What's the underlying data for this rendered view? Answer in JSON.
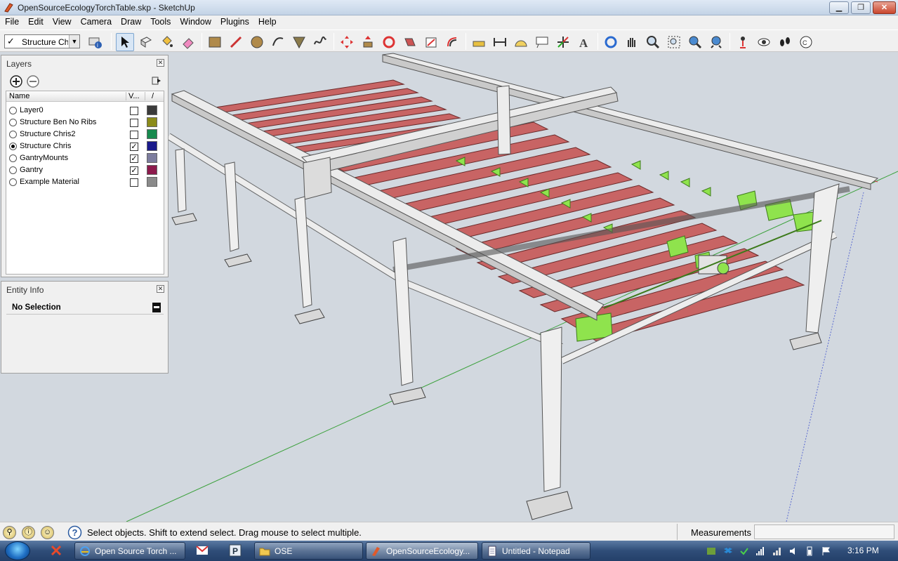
{
  "window": {
    "title": "OpenSourceEcologyTorchTable.skp - SketchUp",
    "minimize": "▁",
    "maximize": "❐",
    "close": "✕"
  },
  "menu": [
    "File",
    "Edit",
    "View",
    "Camera",
    "Draw",
    "Tools",
    "Window",
    "Plugins",
    "Help"
  ],
  "toolbar": {
    "layer_select_value": "Structure Chris",
    "tools": [
      "layer-manager-icon",
      "select-icon",
      "make-component-icon",
      "paint-bucket-icon",
      "eraser-icon",
      "rectangle-icon",
      "line-icon",
      "circle-icon",
      "arc-icon",
      "polygon-icon",
      "freehand-icon",
      "move-icon",
      "push-pull-icon",
      "rotate-icon",
      "follow-me-icon",
      "scale-icon",
      "offset-icon",
      "tape-measure-icon",
      "dimension-icon",
      "protractor-icon",
      "text-icon",
      "axes-icon",
      "3d-text-icon",
      "orbit-icon",
      "pan-icon",
      "zoom-icon",
      "zoom-window-icon",
      "previous-view-icon",
      "zoom-extents-icon",
      "position-camera-icon",
      "look-around-icon",
      "walk-icon",
      "section-plane-icon"
    ]
  },
  "layers_panel": {
    "title": "Layers",
    "col_name": "Name",
    "col_visible": "V...",
    "col_color": "/",
    "rows": [
      {
        "name": "Layer0",
        "active": false,
        "visible": false,
        "color": "#3a3a3a"
      },
      {
        "name": "Structure Ben No Ribs",
        "active": false,
        "visible": false,
        "color": "#8b8b1a"
      },
      {
        "name": "Structure Chris2",
        "active": false,
        "visible": false,
        "color": "#178a4e"
      },
      {
        "name": "Structure Chris",
        "active": true,
        "visible": true,
        "color": "#1a1a8c"
      },
      {
        "name": "GantryMounts",
        "active": false,
        "visible": true,
        "color": "#7d7d9e"
      },
      {
        "name": "Gantry",
        "active": false,
        "visible": true,
        "color": "#8c1a4c"
      },
      {
        "name": "Example Material",
        "active": false,
        "visible": false,
        "color": "#8a8a8a"
      }
    ]
  },
  "entity_panel": {
    "title": "Entity Info",
    "selection": "No Selection"
  },
  "status": {
    "text": "Select objects. Shift to extend select. Drag mouse to select multiple.",
    "measurements_label": "Measurements",
    "measurements_value": ""
  },
  "taskbar": {
    "tasks": [
      {
        "label": "Open Source Torch ...",
        "icon": "ie-icon",
        "active": false
      },
      {
        "label": "OSE",
        "icon": "folder-icon",
        "active": false
      },
      {
        "label": "OpenSourceEcology...",
        "icon": "sketchup-icon",
        "active": true
      },
      {
        "label": "Untitled - Notepad",
        "icon": "notepad-icon",
        "active": false
      }
    ],
    "quick_launch": [
      "close-app-icon",
      "gmail-icon",
      "p-icon"
    ],
    "clock": "3:16 PM"
  },
  "colors": {
    "slat": "#c86464",
    "steel": "#e9e9e9",
    "highlight": "#8fe34d",
    "sky": "#d2d8df"
  }
}
